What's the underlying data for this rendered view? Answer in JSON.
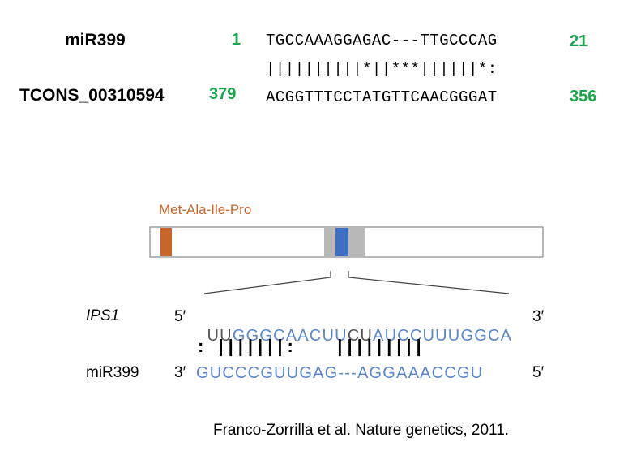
{
  "top_alignment": {
    "query_name": "miR399",
    "query_start": "1",
    "query_seq": "TGCCAAAGGAGAC---TTGCCCAG",
    "query_end": "21",
    "match_line": "||||||||||*||***||||||*:",
    "target_name": "TCONS_00310594",
    "target_start": "379",
    "target_seq": "ACGGTTTCCTATGTTCAACGGGAT",
    "target_end": "356"
  },
  "diagram": {
    "peptide_label": "Met-Ala-Ile-Pro",
    "ips1_label": "IPS1",
    "ips1_five_prime": "5′",
    "ips1_seq_dark1": "UU",
    "ips1_seq_blue1": "GGGCAACUU",
    "ips1_seq_dark2": "CU",
    "ips1_seq_blue2": "AUCCUUUGGCA",
    "ips1_three_prime": "3′",
    "pairing_line": ": |||||||:    |||||||||",
    "mir_label": "miR399",
    "mir_three_prime": "3′",
    "mir_seq": "GUCCCGUUGAG---AGGAAACCGU",
    "mir_five_prime": "5′"
  },
  "colors": {
    "green_numbers": "#1aa64a",
    "peptide_orange": "#c8662a",
    "blue_seq": "#5d86c6",
    "site_blue": "#3f6fc0",
    "site_gray": "#b9b9b9"
  },
  "citation": "Franco-Zorrilla et al. Nature genetics, 2011."
}
